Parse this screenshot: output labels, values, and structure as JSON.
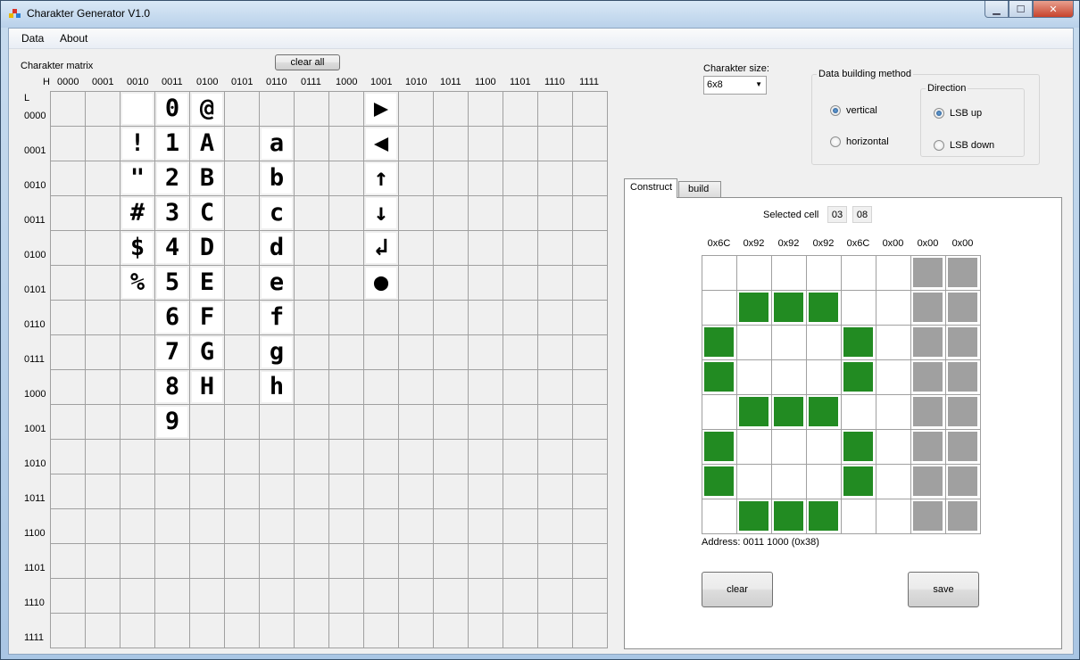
{
  "window": {
    "title": "Charakter Generator V1.0"
  },
  "menu": [
    "Data",
    "About"
  ],
  "matrix": {
    "label": "Charakter matrix",
    "clear_all": "clear all",
    "h_label": "H",
    "l_label": "L",
    "col_headers": [
      "0000",
      "0001",
      "0010",
      "0011",
      "0100",
      "0101",
      "0110",
      "0111",
      "1000",
      "1001",
      "1010",
      "1011",
      "1100",
      "1101",
      "1110",
      "1111"
    ],
    "row_headers": [
      "0000",
      "0001",
      "0010",
      "0011",
      "0100",
      "0101",
      "0110",
      "0111",
      "1000",
      "1001",
      "1010",
      "1011",
      "1100",
      "1101",
      "1110",
      "1111"
    ],
    "glyphs": [
      {
        "col": 2,
        "row": 0,
        "char": ""
      },
      {
        "col": 2,
        "row": 1,
        "char": "!"
      },
      {
        "col": 2,
        "row": 2,
        "char": "\""
      },
      {
        "col": 2,
        "row": 3,
        "char": "#"
      },
      {
        "col": 2,
        "row": 4,
        "char": "$"
      },
      {
        "col": 2,
        "row": 5,
        "char": "%"
      },
      {
        "col": 3,
        "row": 0,
        "char": "0"
      },
      {
        "col": 3,
        "row": 1,
        "char": "1"
      },
      {
        "col": 3,
        "row": 2,
        "char": "2"
      },
      {
        "col": 3,
        "row": 3,
        "char": "3"
      },
      {
        "col": 3,
        "row": 4,
        "char": "4"
      },
      {
        "col": 3,
        "row": 5,
        "char": "5"
      },
      {
        "col": 3,
        "row": 6,
        "char": "6"
      },
      {
        "col": 3,
        "row": 7,
        "char": "7"
      },
      {
        "col": 3,
        "row": 8,
        "char": "8"
      },
      {
        "col": 3,
        "row": 9,
        "char": "9"
      },
      {
        "col": 4,
        "row": 0,
        "char": "@"
      },
      {
        "col": 4,
        "row": 1,
        "char": "A"
      },
      {
        "col": 4,
        "row": 2,
        "char": "B"
      },
      {
        "col": 4,
        "row": 3,
        "char": "C"
      },
      {
        "col": 4,
        "row": 4,
        "char": "D"
      },
      {
        "col": 4,
        "row": 5,
        "char": "E"
      },
      {
        "col": 4,
        "row": 6,
        "char": "F"
      },
      {
        "col": 4,
        "row": 7,
        "char": "G"
      },
      {
        "col": 4,
        "row": 8,
        "char": "H"
      },
      {
        "col": 6,
        "row": 1,
        "char": "a"
      },
      {
        "col": 6,
        "row": 2,
        "char": "b"
      },
      {
        "col": 6,
        "row": 3,
        "char": "c"
      },
      {
        "col": 6,
        "row": 4,
        "char": "d"
      },
      {
        "col": 6,
        "row": 5,
        "char": "e"
      },
      {
        "col": 6,
        "row": 6,
        "char": "f"
      },
      {
        "col": 6,
        "row": 7,
        "char": "g"
      },
      {
        "col": 6,
        "row": 8,
        "char": "h"
      },
      {
        "col": 9,
        "row": 0,
        "char": "▶"
      },
      {
        "col": 9,
        "row": 1,
        "char": "◀"
      },
      {
        "col": 9,
        "row": 2,
        "char": "↑"
      },
      {
        "col": 9,
        "row": 3,
        "char": "↓"
      },
      {
        "col": 9,
        "row": 4,
        "char": "↲"
      },
      {
        "col": 9,
        "row": 5,
        "char": "●"
      }
    ]
  },
  "settings": {
    "size_label": "Charakter size:",
    "size_value": "6x8",
    "method_label": "Data building method",
    "method_options": [
      "vertical",
      "horizontal"
    ],
    "method_selected": "vertical",
    "direction_label": "Direction",
    "direction_options": [
      "LSB up",
      "LSB down"
    ],
    "direction_selected": "LSB up"
  },
  "tabs": [
    "Construct",
    "build"
  ],
  "construct": {
    "selected_label": "Selected cell",
    "selected_col": "03",
    "selected_row": "08",
    "column_hex": [
      "0x6C",
      "0x92",
      "0x92",
      "0x92",
      "0x6C",
      "0x00",
      "0x00",
      "0x00"
    ],
    "pixels": [
      [
        0,
        0,
        0,
        0,
        0,
        0,
        2,
        2
      ],
      [
        0,
        1,
        1,
        1,
        0,
        0,
        2,
        2
      ],
      [
        1,
        0,
        0,
        0,
        1,
        0,
        2,
        2
      ],
      [
        1,
        0,
        0,
        0,
        1,
        0,
        2,
        2
      ],
      [
        0,
        1,
        1,
        1,
        0,
        0,
        2,
        2
      ],
      [
        1,
        0,
        0,
        0,
        1,
        0,
        2,
        2
      ],
      [
        1,
        0,
        0,
        0,
        1,
        0,
        2,
        2
      ],
      [
        0,
        1,
        1,
        1,
        0,
        0,
        2,
        2
      ]
    ],
    "address": "Address: 0011 1000 (0x38)",
    "clear": "clear",
    "save": "save"
  },
  "colors": {
    "pixel_on": "#228b22",
    "pixel_disabled": "#a0a0a0"
  }
}
